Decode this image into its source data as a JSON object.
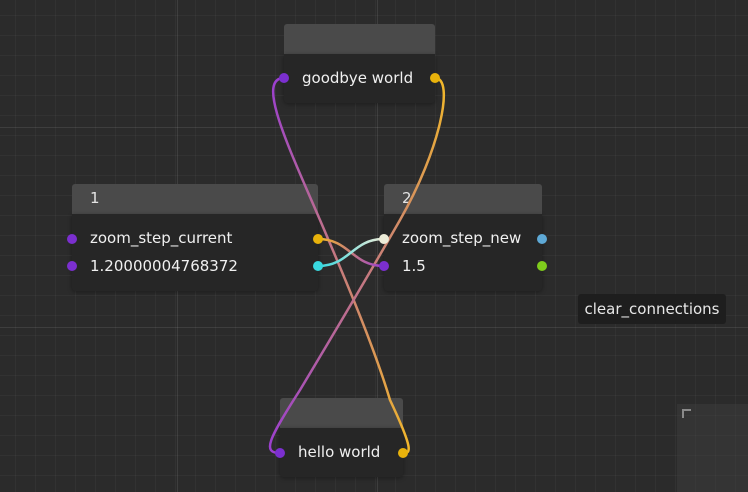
{
  "nodes": {
    "goodbye": {
      "label": "goodbye world"
    },
    "node1": {
      "title": "1",
      "slot_name": "zoom_step_current",
      "slot_value": "1.20000004768372"
    },
    "node2": {
      "title": "2",
      "slot_name": "zoom_step_new",
      "slot_value": "1.5"
    },
    "hello": {
      "label": "hello world"
    }
  },
  "buttons": {
    "clear_connections": "clear_connections"
  },
  "colors": {
    "background": "#2b2b2b",
    "node_title": "#4a4a4a",
    "node_body": "#262626",
    "port_purple": "#7b2fcf",
    "port_yellow": "#e8b20b",
    "port_cyan": "#39d8df",
    "port_white": "#ececd8",
    "port_blue": "#5ea9d6",
    "port_green": "#7fcc1c",
    "wire_purple": "#9b3fcf",
    "wire_yellow": "#f2b82a"
  }
}
